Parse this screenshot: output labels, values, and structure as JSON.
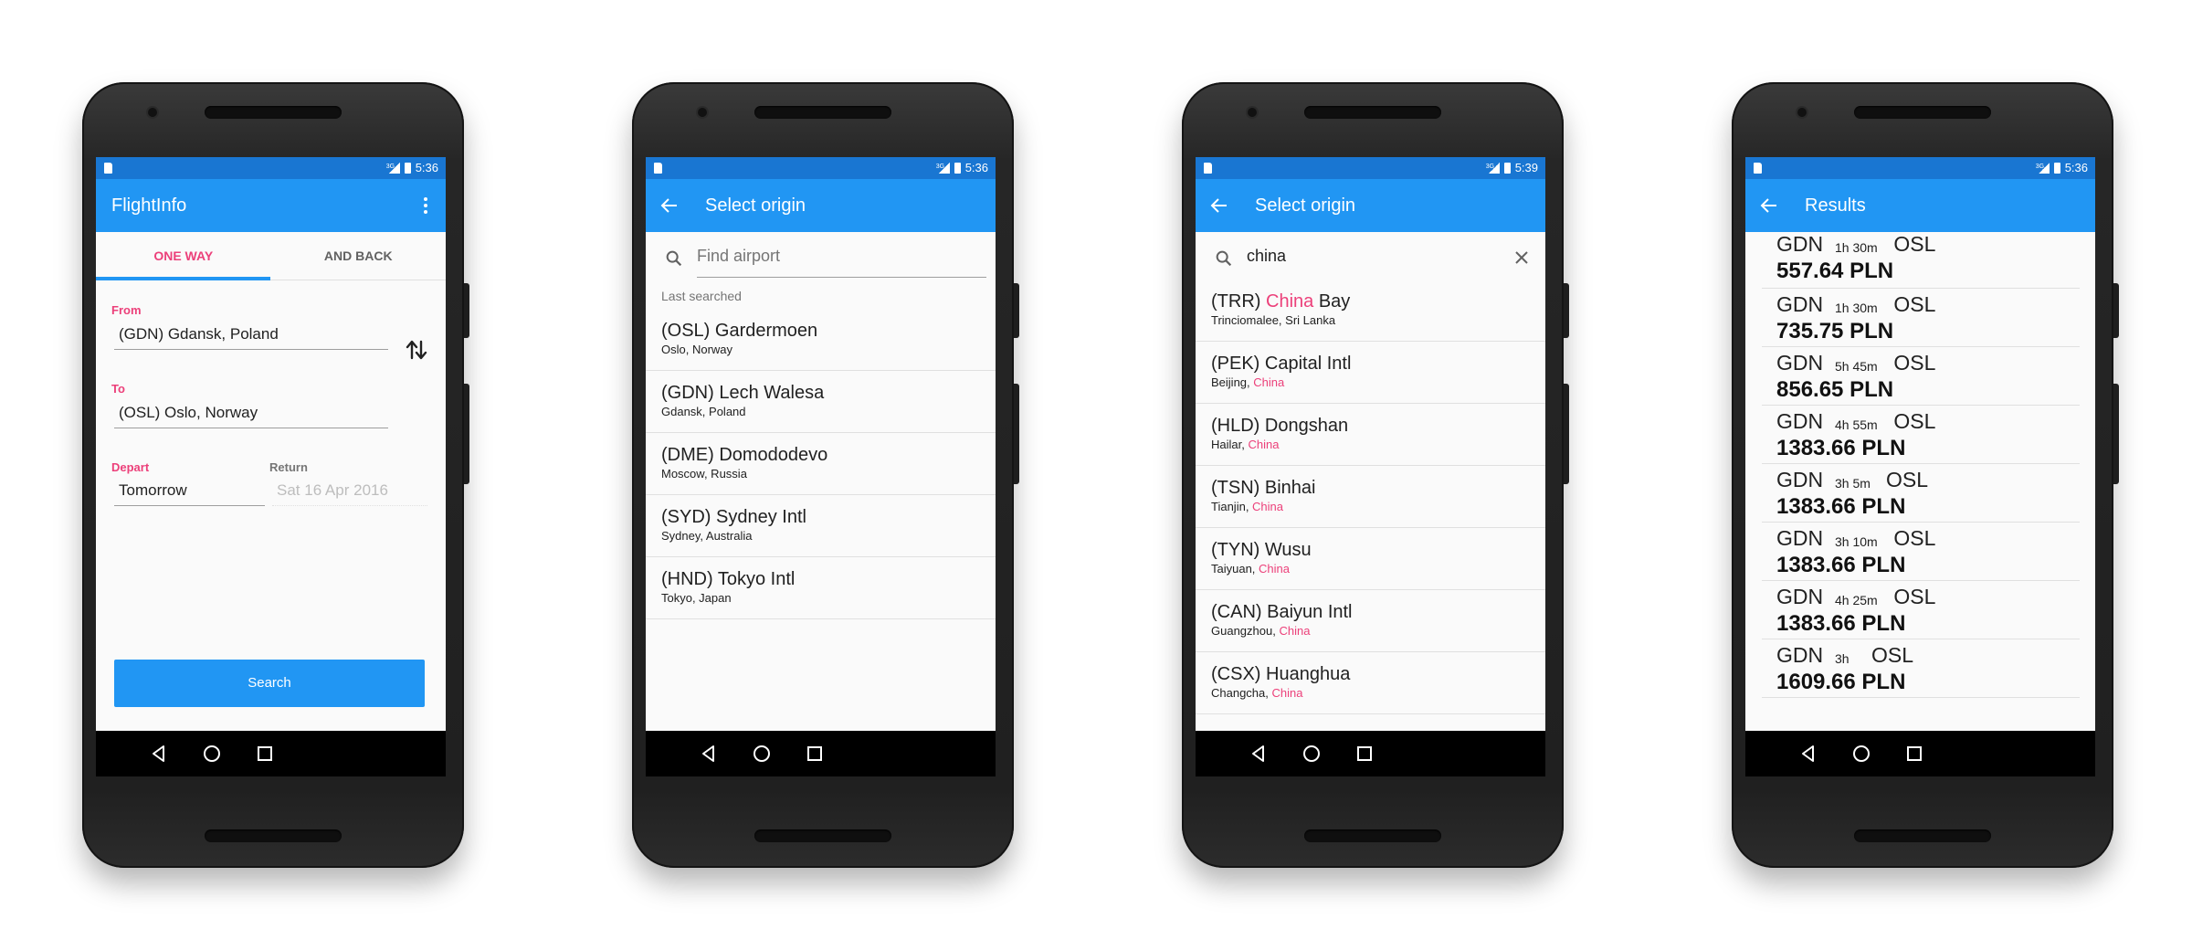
{
  "status": {
    "network": "3G",
    "times": [
      "5:36",
      "5:36",
      "5:39",
      "5:36"
    ]
  },
  "screen1": {
    "app_title": "FlightInfo",
    "tabs": [
      "ONE WAY",
      "AND BACK"
    ],
    "from_label": "From",
    "from_value": "(GDN) Gdansk, Poland",
    "to_label": "To",
    "to_value": "(OSL) Oslo, Norway",
    "depart_label": "Depart",
    "depart_value": "Tomorrow",
    "return_label": "Return",
    "return_value": "Sat 16 Apr 2016",
    "search_button": "Search"
  },
  "screen2": {
    "title": "Select origin",
    "search_placeholder": "Find airport",
    "section_label": "Last searched",
    "items": [
      {
        "name": "(OSL) Gardermoen",
        "location": "Oslo, Norway"
      },
      {
        "name": "(GDN) Lech Walesa",
        "location": "Gdansk, Poland"
      },
      {
        "name": "(DME) Domododevo",
        "location": "Moscow, Russia"
      },
      {
        "name": "(SYD) Sydney Intl",
        "location": "Sydney, Australia"
      },
      {
        "name": "(HND) Tokyo Intl",
        "location": "Tokyo, Japan"
      }
    ]
  },
  "screen3": {
    "title": "Select origin",
    "search_value": "china",
    "highlight": "China",
    "items": [
      {
        "code": "(TRR)",
        "name_pre": "",
        "name_hl": "China",
        "name_post": " Bay",
        "loc_pre": "Trinciomalee, Sri Lanka",
        "loc_hl": ""
      },
      {
        "code": "(PEK)",
        "name_pre": "Capital Intl",
        "name_hl": "",
        "name_post": "",
        "loc_pre": "Beijing, ",
        "loc_hl": "China"
      },
      {
        "code": "(HLD)",
        "name_pre": "Dongshan",
        "name_hl": "",
        "name_post": "",
        "loc_pre": "Hailar, ",
        "loc_hl": "China"
      },
      {
        "code": "(TSN)",
        "name_pre": "Binhai",
        "name_hl": "",
        "name_post": "",
        "loc_pre": "Tianjin, ",
        "loc_hl": "China"
      },
      {
        "code": "(TYN)",
        "name_pre": "Wusu",
        "name_hl": "",
        "name_post": "",
        "loc_pre": "Taiyuan, ",
        "loc_hl": "China"
      },
      {
        "code": "(CAN)",
        "name_pre": "Baiyun Intl",
        "name_hl": "",
        "name_post": "",
        "loc_pre": "Guangzhou, ",
        "loc_hl": "China"
      },
      {
        "code": "(CSX)",
        "name_pre": "Huanghua",
        "name_hl": "",
        "name_post": "",
        "loc_pre": "Changcha, ",
        "loc_hl": "China"
      }
    ]
  },
  "screen4": {
    "title": "Results",
    "results": [
      {
        "from": "GDN",
        "duration": "1h 30m",
        "to": "OSL",
        "price": "557.64 PLN"
      },
      {
        "from": "GDN",
        "duration": "1h 30m",
        "to": "OSL",
        "price": "735.75 PLN"
      },
      {
        "from": "GDN",
        "duration": "5h 45m",
        "to": "OSL",
        "price": "856.65 PLN"
      },
      {
        "from": "GDN",
        "duration": "4h 55m",
        "to": "OSL",
        "price": "1383.66 PLN"
      },
      {
        "from": "GDN",
        "duration": "3h 5m",
        "to": "OSL",
        "price": "1383.66 PLN"
      },
      {
        "from": "GDN",
        "duration": "3h 10m",
        "to": "OSL",
        "price": "1383.66 PLN"
      },
      {
        "from": "GDN",
        "duration": "4h 25m",
        "to": "OSL",
        "price": "1383.66 PLN"
      },
      {
        "from": "GDN",
        "duration": "3h",
        "to": "OSL",
        "price": "1609.66 PLN"
      }
    ]
  },
  "colors": {
    "appbar": "#2196f3",
    "statusbar": "#1976d2",
    "accent": "#ec407a"
  }
}
